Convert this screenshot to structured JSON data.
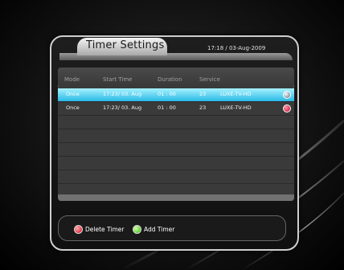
{
  "header": {
    "title": "Timer Settings",
    "datetime": "17:18 / 03-Aug-2009"
  },
  "columns": [
    "Mode",
    "Start Time",
    "Duration",
    "Service"
  ],
  "rows": [
    {
      "mode": "Once",
      "start": "17:23/ 03. Aug",
      "duration": "01 : 00",
      "channel_no": "23",
      "service": "LUXE-TV-HD",
      "selected": true
    },
    {
      "mode": "Once",
      "start": "17:23/ 03. Aug",
      "duration": "01 : 00",
      "channel_no": "23",
      "service": "LUXE-TV-HD",
      "selected": false
    }
  ],
  "buttons": {
    "red": "Delete Timer",
    "green": "Add Timer"
  },
  "colors": {
    "selected_row": "#33c2ee",
    "red_key": "#d00018",
    "green_key": "#2cb800"
  }
}
